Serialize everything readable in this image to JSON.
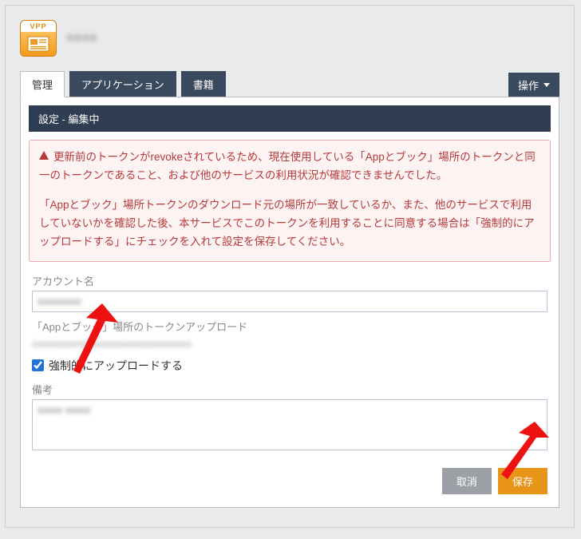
{
  "header": {
    "icon_badge": "VPP",
    "title_masked": "■■■■"
  },
  "tabs": {
    "items": [
      {
        "label": "管理",
        "active": true
      },
      {
        "label": "アプリケーション",
        "active": false
      },
      {
        "label": "書籍",
        "active": false
      }
    ],
    "operation_label": "操作"
  },
  "panel": {
    "title": "設定 - 編集中",
    "alert": {
      "p1": "更新前のトークンがrevokeされているため、現在使用している「Appとブック」場所のトークンと同一のトークンであること、および他のサービスの利用状況が確認できませんでした。",
      "p2": "「Appとブック」場所トークンのダウンロード元の場所が一致しているか、また、他のサービスで利用していないかを確認した後、本サービスでこのトークンを利用することに同意する場合は「強制的にアップロードする」にチェックを入れて設定を保存してください。"
    },
    "fields": {
      "account_label": "アカウント名",
      "account_value_masked": "■■■■■■■",
      "token_label": "「Appとブック」場所のトークンアップロード",
      "token_file_masked": "■■■■■■■■■■■■■■■■■■■■■■■■",
      "force_upload_label": "強制的にアップロードする",
      "force_upload_checked": true,
      "notes_label": "備考",
      "notes_value_masked": "■■■■ ■■■■"
    },
    "buttons": {
      "cancel": "取消",
      "save": "保存"
    }
  }
}
